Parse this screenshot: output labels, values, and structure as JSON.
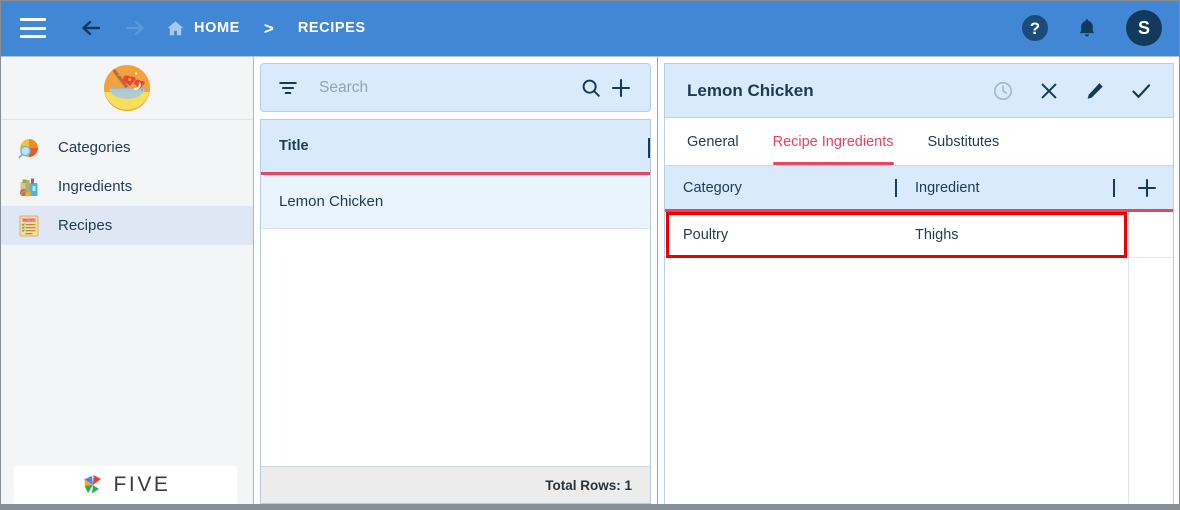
{
  "topbar": {
    "menu_icon": "hamburger-icon",
    "back_icon": "arrow-left-icon",
    "forward_icon": "arrow-right-icon",
    "home_icon": "home-icon",
    "breadcrumb": {
      "home": "HOME",
      "separator": ">",
      "current": "RECIPES"
    },
    "help_label": "?",
    "bell_icon": "bell-icon",
    "avatar_initial": "S",
    "bg_color": "#4287d6",
    "accent_dark": "#123a5c"
  },
  "sidebar": {
    "logo_icon": "recipe-bowl-logo",
    "items": [
      {
        "label": "Categories",
        "icon": "pie-chart-search-icon",
        "active": false
      },
      {
        "label": "Ingredients",
        "icon": "groceries-icon",
        "active": false
      },
      {
        "label": "Recipes",
        "icon": "recipe-card-icon",
        "active": true
      }
    ],
    "footer_brand": "FIVE"
  },
  "list_panel": {
    "search": {
      "placeholder": "Search",
      "value": "",
      "filter_icon": "filter-icon",
      "search_icon": "search-icon",
      "add_icon": "plus-icon"
    },
    "columns": [
      "Title"
    ],
    "rows": [
      {
        "Title": "Lemon Chicken",
        "selected": true
      }
    ],
    "footer": "Total Rows: 1"
  },
  "detail_panel": {
    "title": "Lemon Chicken",
    "actions": [
      {
        "name": "history-clock-icon",
        "disabled": true
      },
      {
        "name": "close-icon",
        "disabled": false
      },
      {
        "name": "edit-pencil-icon",
        "disabled": false
      },
      {
        "name": "save-check-icon",
        "disabled": false
      }
    ],
    "tabs": [
      {
        "label": "General",
        "active": false
      },
      {
        "label": "Recipe Ingredients",
        "active": true
      },
      {
        "label": "Substitutes",
        "active": false
      }
    ],
    "grid": {
      "columns": [
        "Category",
        "Ingredient"
      ],
      "add_icon": "plus-icon",
      "rows": [
        {
          "Category": "Poultry",
          "Ingredient": "Thighs",
          "highlighted": true
        }
      ]
    }
  },
  "colors": {
    "accent_red": "#e8455f",
    "highlight_red": "#ee0000",
    "panel_blue": "#d8eafb",
    "row_blue": "#eaf4fd",
    "text_navy": "#1f3a54"
  }
}
